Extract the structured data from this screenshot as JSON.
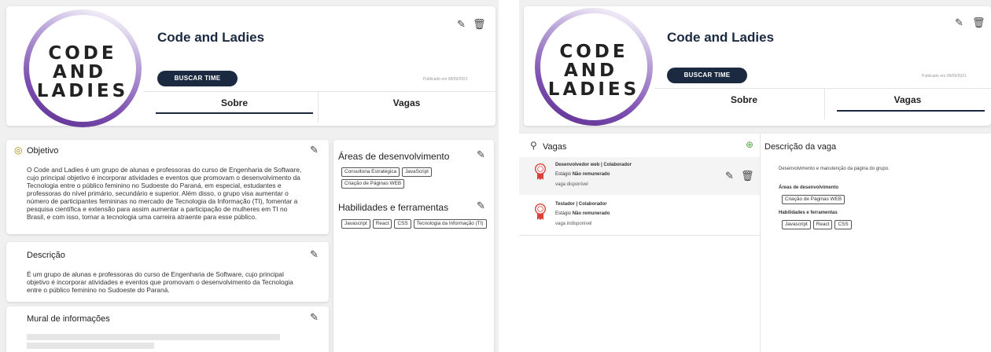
{
  "org": {
    "name": "Code and Ladies",
    "logo_lines": [
      "CODE",
      "AND",
      "LADIES"
    ],
    "search_team_button": "BUSCAR TIME",
    "published": "Publicado em 08/09/2021"
  },
  "tabs": {
    "about": "Sobre",
    "jobs": "Vagas"
  },
  "left": {
    "objective": {
      "title": "Objetivo",
      "text": "O Code and Ladies é um grupo de alunas e professoras do curso de Engenharia de Software, cujo principal objetivo é incorporar atividades e eventos que promovam o desenvolvimento da Tecnologia entre o público feminino no Sudoeste do Paraná, em especial, estudantes e professoras do nível primário, secundário e superior. Além disso, o grupo visa aumentar o número de participantes femininas no mercado de Tecnologia da Informação (TI), fomentar a pesquisa científica e extensão para assim aumentar a participação de mulheres em TI no Brasil, e com isso, tornar a tecnologia uma carreira atraente para esse público."
    },
    "description": {
      "title": "Descrição",
      "text": "É um grupo de alunas e professoras do curso de Engenharia de Software, cujo principal objetivo é incorporar atividades e eventos que promovam o desenvolvimento da Tecnologia entre o público feminino no Sudoeste do Paraná."
    },
    "wall": {
      "title": "Mural de informações"
    },
    "areas": {
      "title": "Áreas de desenvolvimento",
      "chips": [
        "Consultoria Estratégica",
        "JavaScript",
        "Criação de Páginas WEB"
      ]
    },
    "skills": {
      "title": "Habilidades e ferramentas",
      "chips": [
        "Javascript",
        "React",
        "CSS",
        "Tecnologia da Informação (TI)"
      ]
    }
  },
  "right": {
    "jobs_title": "Vagas",
    "jobs": [
      {
        "title": "Desenvolvedor web | Colaborador",
        "type_prefix": "Estágio",
        "pay": "Não remunerado",
        "status": "vaga disponível"
      },
      {
        "title": "Testador | Colaborador",
        "type_prefix": "Estágio",
        "pay": "Não remunerado",
        "status": "vaga indisponível"
      }
    ],
    "detail": {
      "title": "Descrição da vaga",
      "text": "Desenvolvimento e manutenção da página do grupo.",
      "areas_label": "Áreas de desenvolvimento",
      "areas": [
        "Criação de Páginas WEB"
      ],
      "skills_label": "Habilidades e ferramentas",
      "skills": [
        "Javascript",
        "React",
        "CSS"
      ]
    }
  },
  "icons": {
    "edit": "pencil-icon",
    "delete": "trash-icon",
    "objective": "target-icon",
    "search": "magnifier-icon",
    "add": "plus-circle-icon",
    "badge": "award-ribbon-icon"
  },
  "colors": {
    "navy": "#1b2a41",
    "logo_purple": "#5b2d8e",
    "ribbon_red": "#d9423b",
    "add_green": "#5aaa4a"
  }
}
